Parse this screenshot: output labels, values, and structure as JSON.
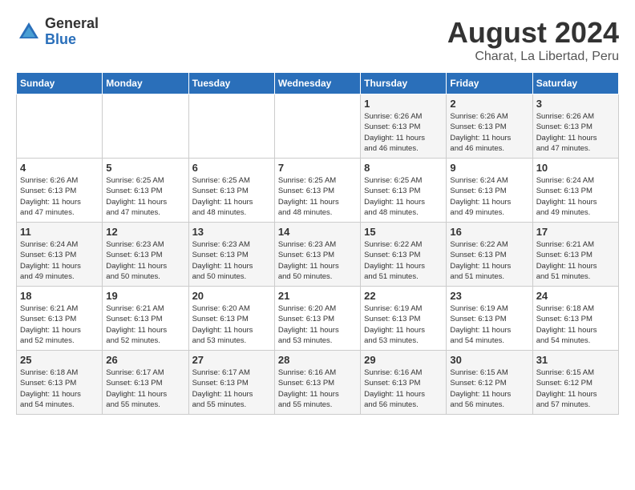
{
  "header": {
    "logo": {
      "line1": "General",
      "line2": "Blue"
    },
    "title": "August 2024",
    "location": "Charat, La Libertad, Peru"
  },
  "days_of_week": [
    "Sunday",
    "Monday",
    "Tuesday",
    "Wednesday",
    "Thursday",
    "Friday",
    "Saturday"
  ],
  "weeks": [
    [
      {
        "day": "",
        "info": ""
      },
      {
        "day": "",
        "info": ""
      },
      {
        "day": "",
        "info": ""
      },
      {
        "day": "",
        "info": ""
      },
      {
        "day": "1",
        "info": "Sunrise: 6:26 AM\nSunset: 6:13 PM\nDaylight: 11 hours\nand 46 minutes."
      },
      {
        "day": "2",
        "info": "Sunrise: 6:26 AM\nSunset: 6:13 PM\nDaylight: 11 hours\nand 46 minutes."
      },
      {
        "day": "3",
        "info": "Sunrise: 6:26 AM\nSunset: 6:13 PM\nDaylight: 11 hours\nand 47 minutes."
      }
    ],
    [
      {
        "day": "4",
        "info": "Sunrise: 6:26 AM\nSunset: 6:13 PM\nDaylight: 11 hours\nand 47 minutes."
      },
      {
        "day": "5",
        "info": "Sunrise: 6:25 AM\nSunset: 6:13 PM\nDaylight: 11 hours\nand 47 minutes."
      },
      {
        "day": "6",
        "info": "Sunrise: 6:25 AM\nSunset: 6:13 PM\nDaylight: 11 hours\nand 48 minutes."
      },
      {
        "day": "7",
        "info": "Sunrise: 6:25 AM\nSunset: 6:13 PM\nDaylight: 11 hours\nand 48 minutes."
      },
      {
        "day": "8",
        "info": "Sunrise: 6:25 AM\nSunset: 6:13 PM\nDaylight: 11 hours\nand 48 minutes."
      },
      {
        "day": "9",
        "info": "Sunrise: 6:24 AM\nSunset: 6:13 PM\nDaylight: 11 hours\nand 49 minutes."
      },
      {
        "day": "10",
        "info": "Sunrise: 6:24 AM\nSunset: 6:13 PM\nDaylight: 11 hours\nand 49 minutes."
      }
    ],
    [
      {
        "day": "11",
        "info": "Sunrise: 6:24 AM\nSunset: 6:13 PM\nDaylight: 11 hours\nand 49 minutes."
      },
      {
        "day": "12",
        "info": "Sunrise: 6:23 AM\nSunset: 6:13 PM\nDaylight: 11 hours\nand 50 minutes."
      },
      {
        "day": "13",
        "info": "Sunrise: 6:23 AM\nSunset: 6:13 PM\nDaylight: 11 hours\nand 50 minutes."
      },
      {
        "day": "14",
        "info": "Sunrise: 6:23 AM\nSunset: 6:13 PM\nDaylight: 11 hours\nand 50 minutes."
      },
      {
        "day": "15",
        "info": "Sunrise: 6:22 AM\nSunset: 6:13 PM\nDaylight: 11 hours\nand 51 minutes."
      },
      {
        "day": "16",
        "info": "Sunrise: 6:22 AM\nSunset: 6:13 PM\nDaylight: 11 hours\nand 51 minutes."
      },
      {
        "day": "17",
        "info": "Sunrise: 6:21 AM\nSunset: 6:13 PM\nDaylight: 11 hours\nand 51 minutes."
      }
    ],
    [
      {
        "day": "18",
        "info": "Sunrise: 6:21 AM\nSunset: 6:13 PM\nDaylight: 11 hours\nand 52 minutes."
      },
      {
        "day": "19",
        "info": "Sunrise: 6:21 AM\nSunset: 6:13 PM\nDaylight: 11 hours\nand 52 minutes."
      },
      {
        "day": "20",
        "info": "Sunrise: 6:20 AM\nSunset: 6:13 PM\nDaylight: 11 hours\nand 53 minutes."
      },
      {
        "day": "21",
        "info": "Sunrise: 6:20 AM\nSunset: 6:13 PM\nDaylight: 11 hours\nand 53 minutes."
      },
      {
        "day": "22",
        "info": "Sunrise: 6:19 AM\nSunset: 6:13 PM\nDaylight: 11 hours\nand 53 minutes."
      },
      {
        "day": "23",
        "info": "Sunrise: 6:19 AM\nSunset: 6:13 PM\nDaylight: 11 hours\nand 54 minutes."
      },
      {
        "day": "24",
        "info": "Sunrise: 6:18 AM\nSunset: 6:13 PM\nDaylight: 11 hours\nand 54 minutes."
      }
    ],
    [
      {
        "day": "25",
        "info": "Sunrise: 6:18 AM\nSunset: 6:13 PM\nDaylight: 11 hours\nand 54 minutes."
      },
      {
        "day": "26",
        "info": "Sunrise: 6:17 AM\nSunset: 6:13 PM\nDaylight: 11 hours\nand 55 minutes."
      },
      {
        "day": "27",
        "info": "Sunrise: 6:17 AM\nSunset: 6:13 PM\nDaylight: 11 hours\nand 55 minutes."
      },
      {
        "day": "28",
        "info": "Sunrise: 6:16 AM\nSunset: 6:13 PM\nDaylight: 11 hours\nand 55 minutes."
      },
      {
        "day": "29",
        "info": "Sunrise: 6:16 AM\nSunset: 6:13 PM\nDaylight: 11 hours\nand 56 minutes."
      },
      {
        "day": "30",
        "info": "Sunrise: 6:15 AM\nSunset: 6:12 PM\nDaylight: 11 hours\nand 56 minutes."
      },
      {
        "day": "31",
        "info": "Sunrise: 6:15 AM\nSunset: 6:12 PM\nDaylight: 11 hours\nand 57 minutes."
      }
    ]
  ]
}
